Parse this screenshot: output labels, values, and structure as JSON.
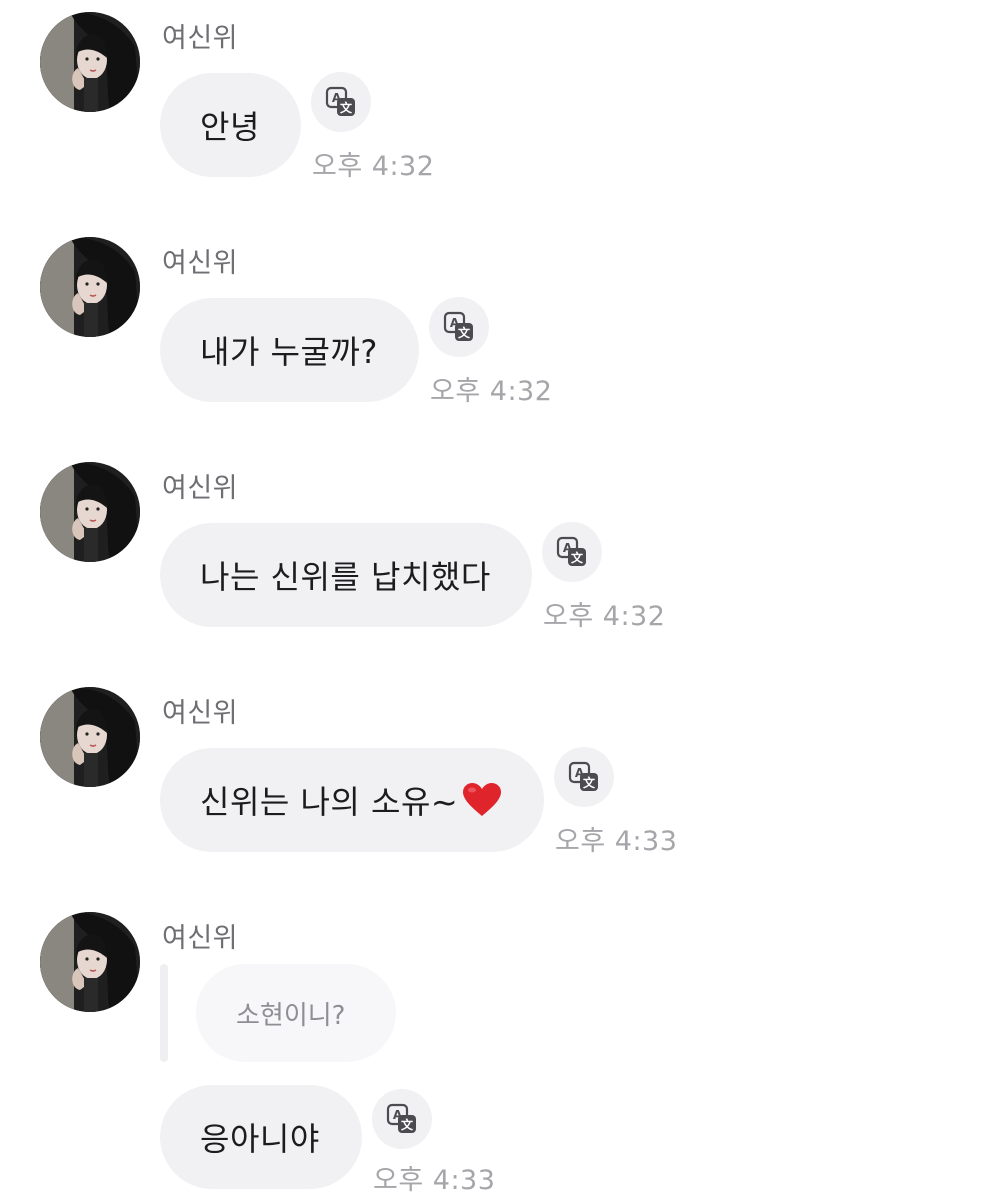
{
  "chat": {
    "messages": [
      {
        "sender": "여신위",
        "text": "안녕",
        "time": "오후 4:32"
      },
      {
        "sender": "여신위",
        "text": "내가 누굴까?",
        "time": "오후 4:32"
      },
      {
        "sender": "여신위",
        "text": "나는 신위를 납치했다",
        "time": "오후 4:32"
      },
      {
        "sender": "여신위",
        "text": "신위는 나의 소유~",
        "emoji": "red-heart",
        "time": "오후 4:33"
      },
      {
        "sender": "여신위",
        "reply_to": "소현이니?",
        "text": "응아니야",
        "time": "오후 4:33"
      }
    ]
  },
  "icons": {
    "translate": "translate-icon",
    "heart": "red-heart-emoji"
  },
  "colors": {
    "bubble": "#f1f1f4",
    "sender": "#6e6e73",
    "time": "#a5a5aa",
    "heart": "#e0242c"
  }
}
